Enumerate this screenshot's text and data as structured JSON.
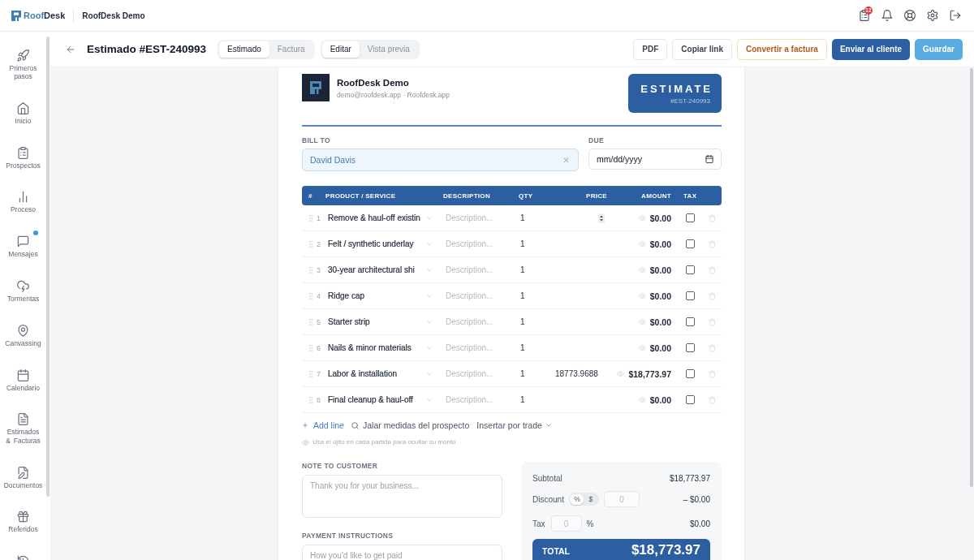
{
  "app_header": {
    "brand": {
      "accent": "Roof",
      "rest": "Desk"
    },
    "workspace": "RoofDesk Demo",
    "task_count": "12"
  },
  "sidebar": {
    "items": [
      {
        "label": "Primeros pasos",
        "unread": false
      },
      {
        "label": "Inicio",
        "unread": false
      },
      {
        "label": "Prospectos",
        "unread": false
      },
      {
        "label": "Proceso",
        "unread": false
      },
      {
        "label": "Mensajes",
        "unread": true
      },
      {
        "label": "Tormentas",
        "unread": false
      },
      {
        "label": "Canvassing",
        "unread": false
      },
      {
        "label": "Calendario",
        "unread": false
      },
      {
        "label": "Estimados & Facturas",
        "unread": false
      },
      {
        "label": "Documentos",
        "unread": false
      },
      {
        "label": "Referidos",
        "unread": false
      }
    ]
  },
  "toolbar": {
    "title": "Estimado #EST-240993",
    "doc_type_tabs": [
      {
        "label": "Estimado",
        "selected": true
      },
      {
        "label": "Factura",
        "selected": false
      }
    ],
    "mode_tabs": [
      {
        "label": "Editar",
        "selected": true
      },
      {
        "label": "Vista previa",
        "selected": false
      }
    ],
    "actions": [
      {
        "label": "PDF",
        "kind": "outline"
      },
      {
        "label": "Copiar link",
        "kind": "outline"
      },
      {
        "label": "Convertir a factura",
        "kind": "warning"
      },
      {
        "label": "Enviar al cliente",
        "kind": "primary"
      },
      {
        "label": "Guardar",
        "kind": "accent"
      }
    ]
  },
  "document": {
    "company": {
      "name": "RoofDesk Demo",
      "contact": "demo@roofdesk.app · Roofdesk.app"
    },
    "badge": {
      "title": "ESTIMATE",
      "number": "#EST-240993"
    },
    "bill_to": {
      "label": "BILL TO",
      "value": "David Davis"
    },
    "due": {
      "label": "DUE",
      "placeholder": "mm/dd/yyyy"
    },
    "table": {
      "columns": [
        "#",
        "PRODUCT / SERVICE",
        "DESCRIPTION",
        "QTY",
        "PRICE",
        "AMOUNT",
        "TAX"
      ],
      "rows": [
        {
          "number": "1",
          "product": "Remove & haul-off existin",
          "description": {
            "placeholder": "Description..."
          },
          "qty": "1",
          "price_focused": true,
          "amount": "$0.00",
          "taxable": false
        },
        {
          "number": "2",
          "product": "Felt / synthetic underlay",
          "description": {
            "placeholder": "Description..."
          },
          "qty": "1",
          "price_focused": false,
          "amount": "$0.00",
          "taxable": false
        },
        {
          "number": "3",
          "product": "30-year architectural shi",
          "description": {
            "placeholder": "Description..."
          },
          "qty": "1",
          "price_focused": false,
          "amount": "$0.00",
          "taxable": false
        },
        {
          "number": "4",
          "product": "Ridge cap",
          "description": {
            "placeholder": "Description..."
          },
          "qty": "1",
          "price_focused": false,
          "amount": "$0.00",
          "taxable": false
        },
        {
          "number": "5",
          "product": "Starter strip",
          "description": {
            "placeholder": "Description..."
          },
          "qty": "1",
          "price_focused": false,
          "amount": "$0.00",
          "taxable": false
        },
        {
          "number": "6",
          "product": "Nails & minor materials",
          "description": {
            "placeholder": "Description..."
          },
          "qty": "1",
          "price_focused": false,
          "amount": "$0.00",
          "taxable": false
        },
        {
          "number": "7",
          "product": "Labor & installation",
          "description": {
            "placeholder": "Description..."
          },
          "qty": "1",
          "price": "18773.9688",
          "price_focused": false,
          "amount": "$18,773.97",
          "taxable": false
        },
        {
          "number": "8",
          "product": "Final cleanup & haul-off",
          "description": {
            "placeholder": "Description..."
          },
          "qty": "1",
          "price_focused": false,
          "amount": "$0.00",
          "taxable": false
        }
      ]
    },
    "line_actions": [
      {
        "label": "Add line",
        "kind": "add"
      },
      {
        "label": "Jalar medidas del prospecto",
        "kind": "search"
      },
      {
        "label": "Insertar por trade",
        "kind": "dropdown"
      }
    ],
    "hint": "Usa el ojito en cada partida para ocultar su monto",
    "note": {
      "label": "NOTE TO CUSTOMER",
      "placeholder": "Thank you for your business..."
    },
    "payment_instructions": {
      "label": "PAYMENT INSTRUCTIONS",
      "placeholder": "How you'd like to get paid"
    },
    "summary": {
      "subtotal": {
        "label": "Subtotal",
        "value": "$18,773.97"
      },
      "discount": {
        "label": "Discount",
        "modes": [
          {
            "label": "%",
            "selected": true
          },
          {
            "label": "$",
            "selected": false
          }
        ],
        "placeholder": "0",
        "value": "– $0.00"
      },
      "tax": {
        "label": "Tax",
        "placeholder": "0",
        "unit": "%",
        "value": "$0.00"
      },
      "total": {
        "label": "TOTAL",
        "value": "$18,773.97"
      }
    }
  }
}
